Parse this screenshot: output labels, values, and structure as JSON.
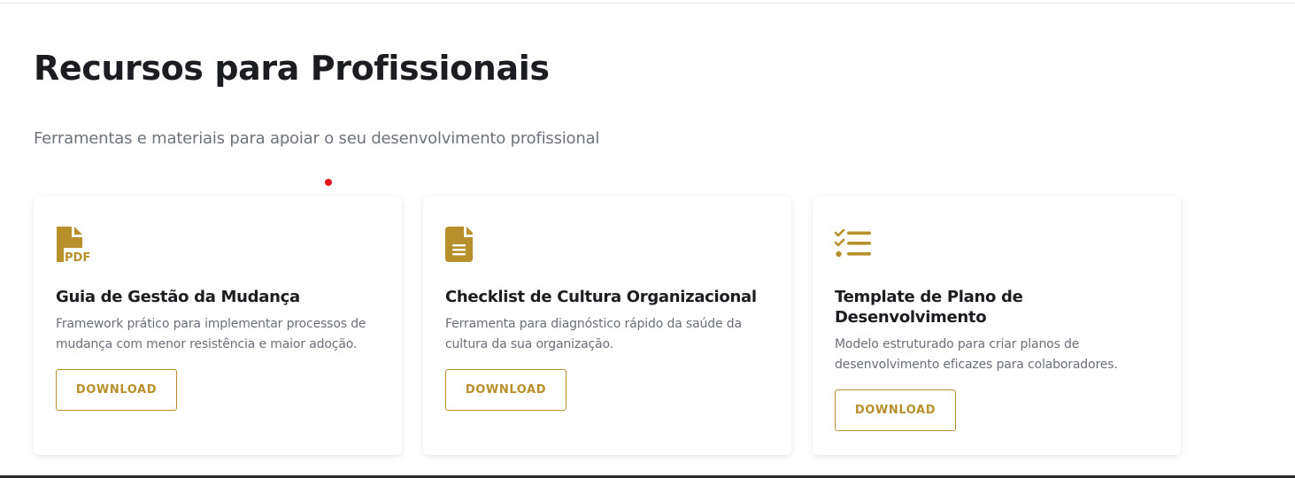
{
  "section": {
    "title": "Recursos para Profissionais",
    "subtitle": "Ferramentas e materiais para apoiar o seu desenvolvimento profissional"
  },
  "colors": {
    "accent": "#b8902b",
    "title": "#1c1d21",
    "text_muted": "#6a6f77",
    "indicator": "#e3141c"
  },
  "cards": [
    {
      "icon": "file-pdf-icon",
      "title": "Guia de Gestão da Mudança",
      "description": "Framework prático para implementar processos de mudança com menor resistência e maior adoção.",
      "button_label": "DOWNLOAD"
    },
    {
      "icon": "file-lines-icon",
      "title": "Checklist de Cultura Organizacional",
      "description": "Ferramenta para diagnóstico rápido da saúde da cultura da sua organização.",
      "button_label": "DOWNLOAD"
    },
    {
      "icon": "list-check-icon",
      "title": "Template de Plano de Desenvolvimento",
      "description": "Modelo estruturado para criar planos de desenvolvimento eficazes para colaboradores.",
      "button_label": "DOWNLOAD"
    }
  ]
}
